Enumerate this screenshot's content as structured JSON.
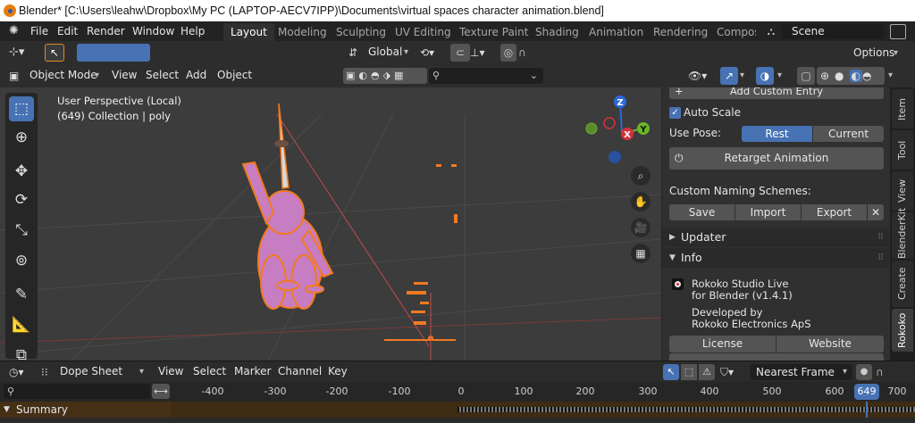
{
  "window": {
    "title": "Blender* [C:\\Users\\leahw\\Dropbox\\My PC (LAPTOP-AECV7IPP)\\Documents\\virtual spaces character animation.blend]"
  },
  "menu": [
    "File",
    "Edit",
    "Render",
    "Window",
    "Help"
  ],
  "workspaces": [
    "Layout",
    "Modeling",
    "Sculpting",
    "UV Editing",
    "Texture Paint",
    "Shading",
    "Animation",
    "Rendering",
    "Compos"
  ],
  "scene_label": "Scene",
  "toolbar": {
    "transform_orientation": "Global",
    "options_label": "Options"
  },
  "viewport_header": {
    "mode": "Object Mode",
    "menus": [
      "View",
      "Select",
      "Add",
      "Object"
    ]
  },
  "viewport": {
    "perspective": "User Perspective (Local)",
    "collection_info": "(649) Collection | poly"
  },
  "gizmo": {
    "z": "Z",
    "y": "Y",
    "x": "X"
  },
  "npanel": {
    "add_custom_entry": "Add Custom Entry",
    "auto_scale": "Auto Scale",
    "use_pose_label": "Use Pose:",
    "rest": "Rest",
    "current": "Current",
    "retarget": "Retarget Animation",
    "naming_schemes": "Custom Naming Schemes:",
    "save": "Save",
    "import": "Import",
    "export": "Export",
    "updater": "Updater",
    "info": "Info",
    "studio_line1": "Rokoko Studio Live",
    "studio_line2": "for Blender (v1.4.1)",
    "dev_line1": "Developed by",
    "dev_line2": "Rokoko Electronics ApS",
    "license": "License",
    "website": "Website"
  },
  "ntabs": [
    "Item",
    "Tool",
    "View",
    "BlenderKit",
    "Create",
    "Rokoko"
  ],
  "dopesheet": {
    "editor": "Dope Sheet",
    "menus": [
      "View",
      "Select",
      "Marker",
      "Channel",
      "Key"
    ],
    "snap": "Nearest Frame",
    "summary": "Summary"
  },
  "timeline": {
    "ticks": [
      "-400",
      "-300",
      "-200",
      "-100",
      "0",
      "100",
      "200",
      "300",
      "400",
      "500",
      "600",
      "700"
    ],
    "current_frame": "649"
  },
  "colors": {
    "accent": "#4772b3",
    "selection": "#f27a21",
    "mesh": "#c77dc1"
  }
}
